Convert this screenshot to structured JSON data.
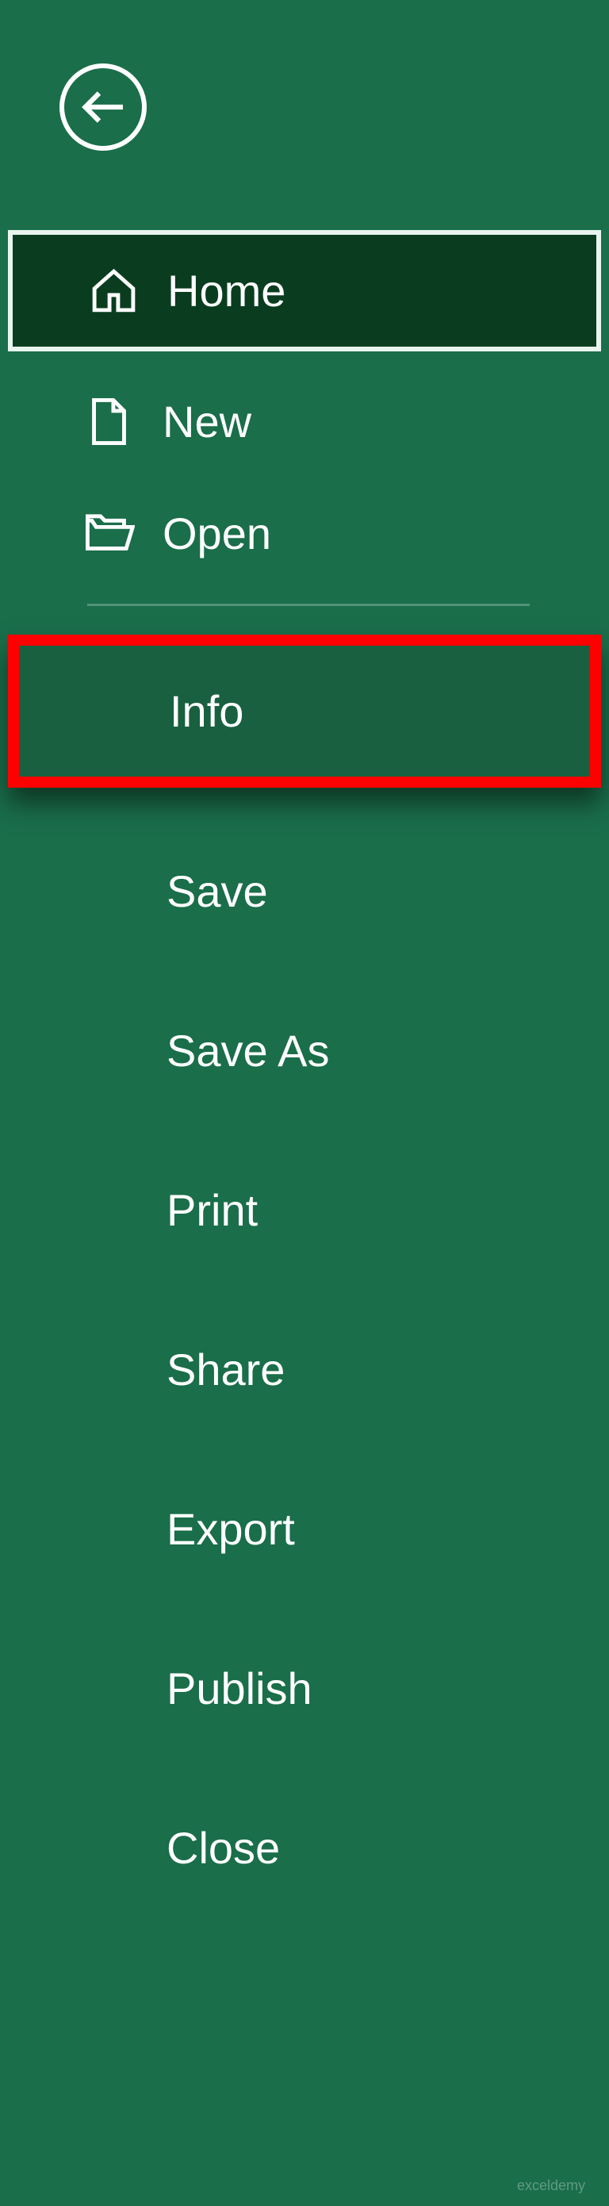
{
  "menu": {
    "home": "Home",
    "new": "New",
    "open": "Open",
    "info": "Info",
    "save": "Save",
    "save_as": "Save As",
    "print": "Print",
    "share": "Share",
    "export": "Export",
    "publish": "Publish",
    "close": "Close"
  },
  "watermark": "exceldemy"
}
